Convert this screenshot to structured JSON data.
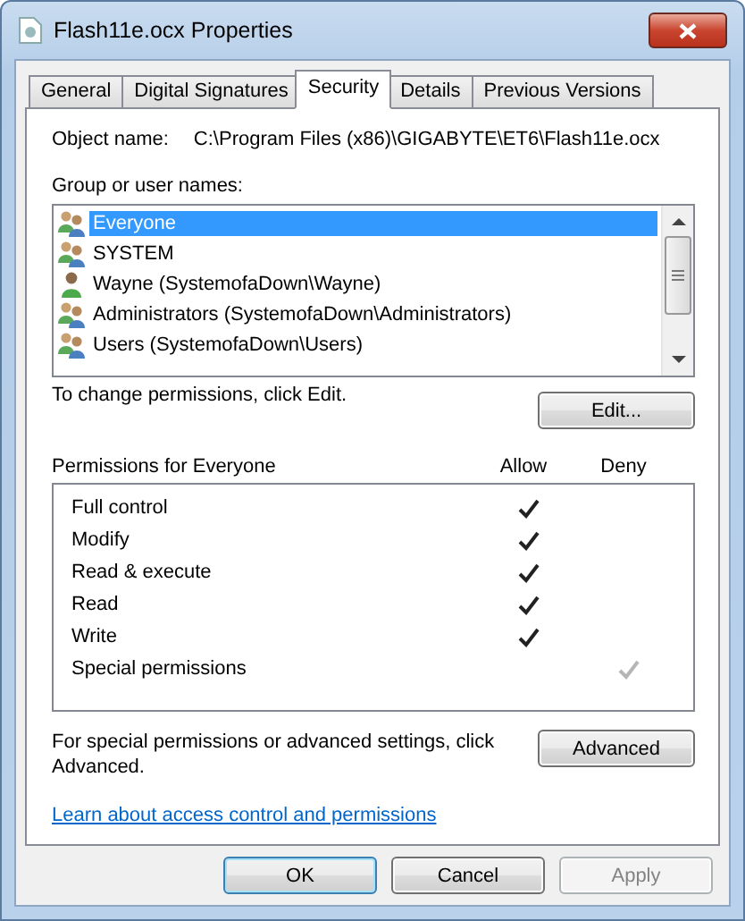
{
  "window": {
    "title": "Flash11e.ocx Properties"
  },
  "tabs": [
    {
      "label": "General",
      "selected": false
    },
    {
      "label": "Digital Signatures",
      "selected": false
    },
    {
      "label": "Security",
      "selected": true
    },
    {
      "label": "Details",
      "selected": false
    },
    {
      "label": "Previous Versions",
      "selected": false
    }
  ],
  "object_name": {
    "label": "Object name:",
    "value": "C:\\Program Files (x86)\\GIGABYTE\\ET6\\Flash11e.ocx"
  },
  "users": {
    "label": "Group or user names:",
    "items": [
      {
        "name": "Everyone",
        "kind": "group",
        "selected": true
      },
      {
        "name": "SYSTEM",
        "kind": "group",
        "selected": false
      },
      {
        "name": "Wayne (SystemofaDown\\Wayne)",
        "kind": "user",
        "selected": false
      },
      {
        "name": "Administrators (SystemofaDown\\Administrators)",
        "kind": "group",
        "selected": false
      },
      {
        "name": "Users (SystemofaDown\\Users)",
        "kind": "group",
        "selected": false
      }
    ]
  },
  "change_hint": "To change permissions, click Edit.",
  "edit_button": "Edit...",
  "permissions": {
    "title": "Permissions for Everyone",
    "allow_heading": "Allow",
    "deny_heading": "Deny",
    "rows": [
      {
        "name": "Full control",
        "allow": true,
        "deny": false,
        "dimmed": false
      },
      {
        "name": "Modify",
        "allow": true,
        "deny": false,
        "dimmed": false
      },
      {
        "name": "Read & execute",
        "allow": true,
        "deny": false,
        "dimmed": false
      },
      {
        "name": "Read",
        "allow": true,
        "deny": false,
        "dimmed": false
      },
      {
        "name": "Write",
        "allow": true,
        "deny": false,
        "dimmed": false
      },
      {
        "name": "Special permissions",
        "allow": false,
        "deny": true,
        "dimmed": true
      }
    ]
  },
  "advanced_hint": "For special permissions or advanced settings, click Advanced.",
  "advanced_button": "Advanced",
  "learn_link": "Learn about access control and permissions",
  "buttons": [
    {
      "label": "OK",
      "default": true,
      "disabled": false
    },
    {
      "label": "Cancel",
      "default": false,
      "disabled": false
    },
    {
      "label": "Apply",
      "default": false,
      "disabled": true
    }
  ]
}
